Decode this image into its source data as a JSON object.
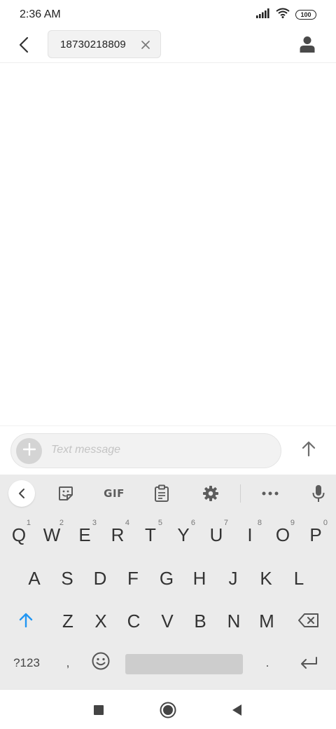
{
  "status_bar": {
    "time": "2:36 AM",
    "battery": "100",
    "icons": [
      "signal-icon",
      "wifi-icon",
      "battery-icon"
    ]
  },
  "header": {
    "recipient": "18730218809",
    "icons": [
      "back-arrow-icon",
      "chip-close-icon",
      "contact-person-icon"
    ]
  },
  "compose": {
    "placeholder": "Text message",
    "icons": [
      "plus-icon",
      "send-arrow-icon"
    ]
  },
  "keyboard": {
    "toolbar": {
      "gif_label": "GIF",
      "icons": [
        "collapse-chevron-icon",
        "sticker-icon",
        "clipboard-icon",
        "settings-gear-icon",
        "more-dots-icon",
        "microphone-icon"
      ]
    },
    "row1": [
      "Q",
      "W",
      "E",
      "R",
      "T",
      "Y",
      "U",
      "I",
      "O",
      "P"
    ],
    "row1_hints": [
      "1",
      "2",
      "3",
      "4",
      "5",
      "6",
      "7",
      "8",
      "9",
      "0"
    ],
    "row2": [
      "A",
      "S",
      "D",
      "F",
      "G",
      "H",
      "J",
      "K",
      "L"
    ],
    "row3": [
      "Z",
      "X",
      "C",
      "V",
      "B",
      "N",
      "M"
    ],
    "row4": {
      "symbols": "?123",
      "comma": ",",
      "period": "."
    },
    "icons": [
      "shift-arrow-icon",
      "backspace-icon",
      "emoji-icon",
      "enter-icon"
    ]
  },
  "nav_bar": {
    "icons": [
      "recents-square-icon",
      "home-circle-icon",
      "back-triangle-icon"
    ]
  },
  "colors": {
    "accent": "#2196f3",
    "keyboard_bg": "#ebebeb",
    "chip_bg": "#f2f2f2"
  }
}
